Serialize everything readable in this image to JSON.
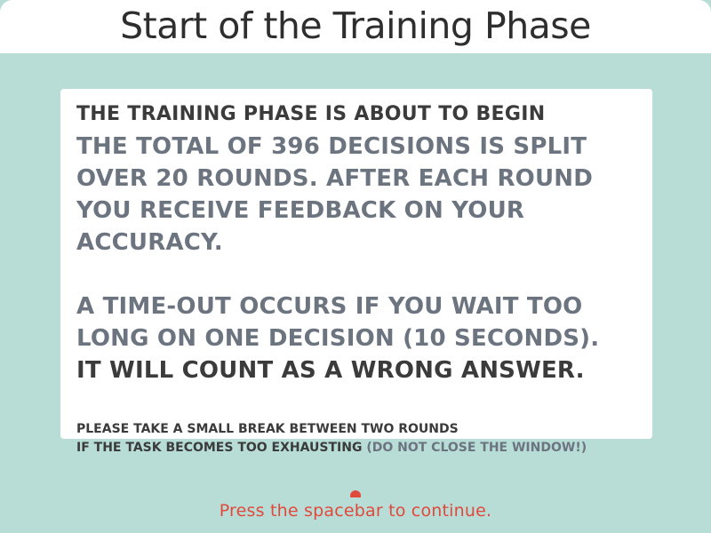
{
  "header": {
    "title": "Start of the Training Phase"
  },
  "card": {
    "heading": "THE TRAINING PHASE IS ABOUT TO BEGIN",
    "paragraph1": "THE TOTAL OF 396 DECISIONS IS SPLIT OVER 20 ROUNDS. AFTER EACH ROUND YOU RECEIVE FEEDBACK ON YOUR ACCURACY.",
    "paragraph2_muted": "A TIME-OUT OCCURS IF YOU WAIT TOO LONG ON ONE DECISION (10 SECONDS).",
    "paragraph2_emph": "IT WILL COUNT AS A WRONG ANSWER.",
    "note_line1": "PLEASE TAKE A SMALL BREAK BETWEEN TWO ROUNDS",
    "note_line2_main": "IF THE TASK BECOMES TOO EXHAUSTING",
    "note_line2_muted": "(DO NOT CLOSE THE WINDOW!)"
  },
  "footer": {
    "prompt": "Press the spacebar to continue."
  },
  "colors": {
    "background": "#b8ddd6",
    "panel": "#ffffff",
    "dark_text": "#3b3b3b",
    "muted_text": "#6c7480",
    "accent": "#e0493b"
  },
  "icons": {
    "cursor": "cursor-icon"
  }
}
